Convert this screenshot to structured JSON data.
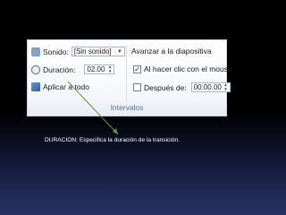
{
  "ribbon": {
    "sound_label": "Sonido:",
    "sound_value": "[Sin sonido]",
    "duration_label": "Duración:",
    "duration_value": "02.00",
    "apply_all_label": "Aplicar a todo",
    "advance_label": "Avanzar a la diapositiva",
    "on_click_label": "Al hacer clic con el mouse",
    "on_click_checked": true,
    "after_label": "Después de:",
    "after_checked": false,
    "after_value": "00:00.00",
    "group_label": "Intervalos"
  },
  "caption": {
    "text": "DURACION: Especifica la duración de la transición."
  },
  "colors": {
    "arrow": "#6b8f3a",
    "background_top": "#000000",
    "background_bottom": "#283366"
  }
}
